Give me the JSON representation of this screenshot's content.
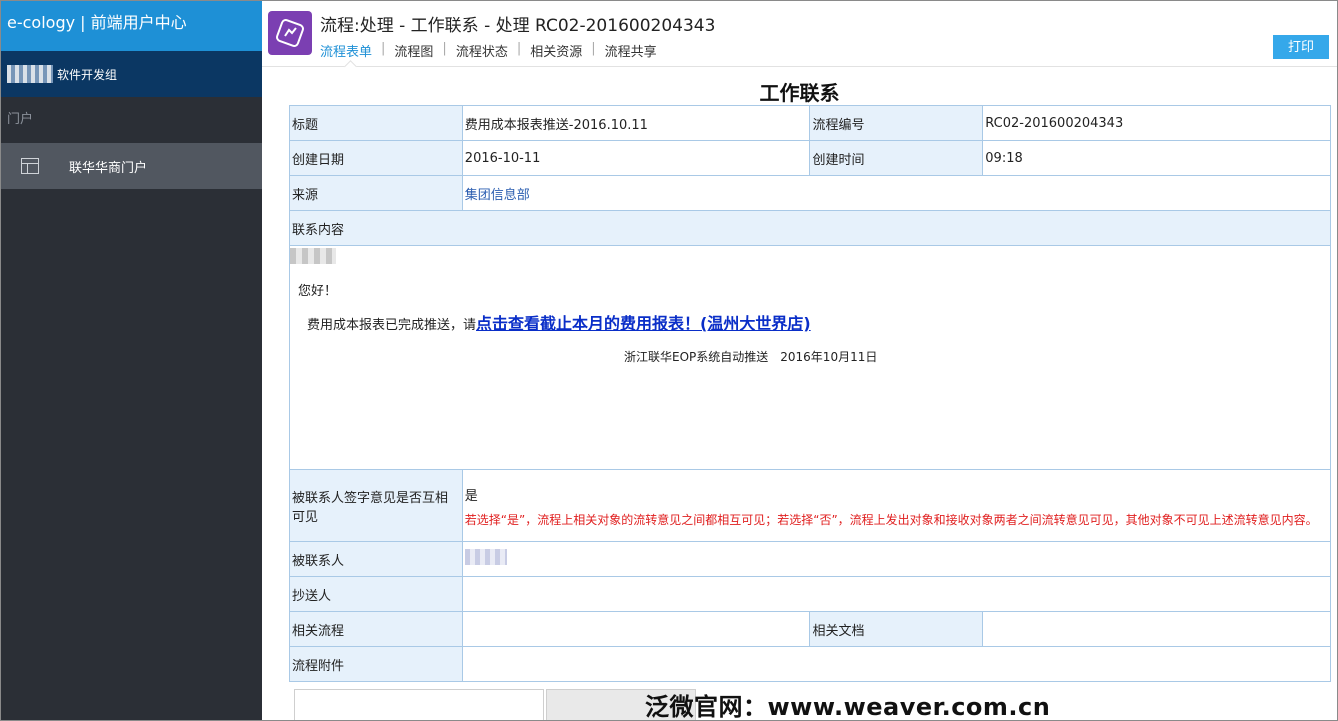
{
  "sidebar": {
    "header": "e-cology | 前端用户中心",
    "group_label": "软件开发组",
    "section_label": "门户",
    "items": [
      {
        "label": "联华华商门户"
      }
    ]
  },
  "topbar": {
    "title": "流程:处理 - 工作联系 - 处理 RC02-201600204343",
    "tabs": [
      "流程表单",
      "流程图",
      "流程状态",
      "相关资源",
      "流程共享"
    ],
    "print_label": "打印"
  },
  "form": {
    "title": "工作联系",
    "subject_label": "标题",
    "subject_value": "费用成本报表推送-2016.10.11",
    "flow_no_label": "流程编号",
    "flow_no_value": "RC02-201600204343",
    "create_date_label": "创建日期",
    "create_date_value": "2016-10-11",
    "create_time_label": "创建时间",
    "create_time_value": "09:18",
    "source_label": "来源",
    "source_value": "集团信息部",
    "content_label": "联系内容",
    "content": {
      "greeting": "您好！",
      "message_prefix": "费用成本报表已完成推送，请",
      "message_link": "点击查看截止本月的费用报表！(温州大世界店)",
      "footer": "浙江联华EOP系统自动推送　2016年10月11日"
    },
    "visible_label": "被联系人签字意见是否互相可见",
    "visible_value": "是",
    "visible_note": "若选择“是”，流程上相关对象的流转意见之间都相互可见；若选择“否”，流程上发出对象和接收对象两者之间流转意见可见，其他对象不可见上述流转意见内容。",
    "contact_label": "被联系人",
    "cc_label": "抄送人",
    "related_flow_label": "相关流程",
    "related_doc_label": "相关文档",
    "attachment_label": "流程附件"
  },
  "watermark": "泛微官网：www.weaver.com.cn"
}
